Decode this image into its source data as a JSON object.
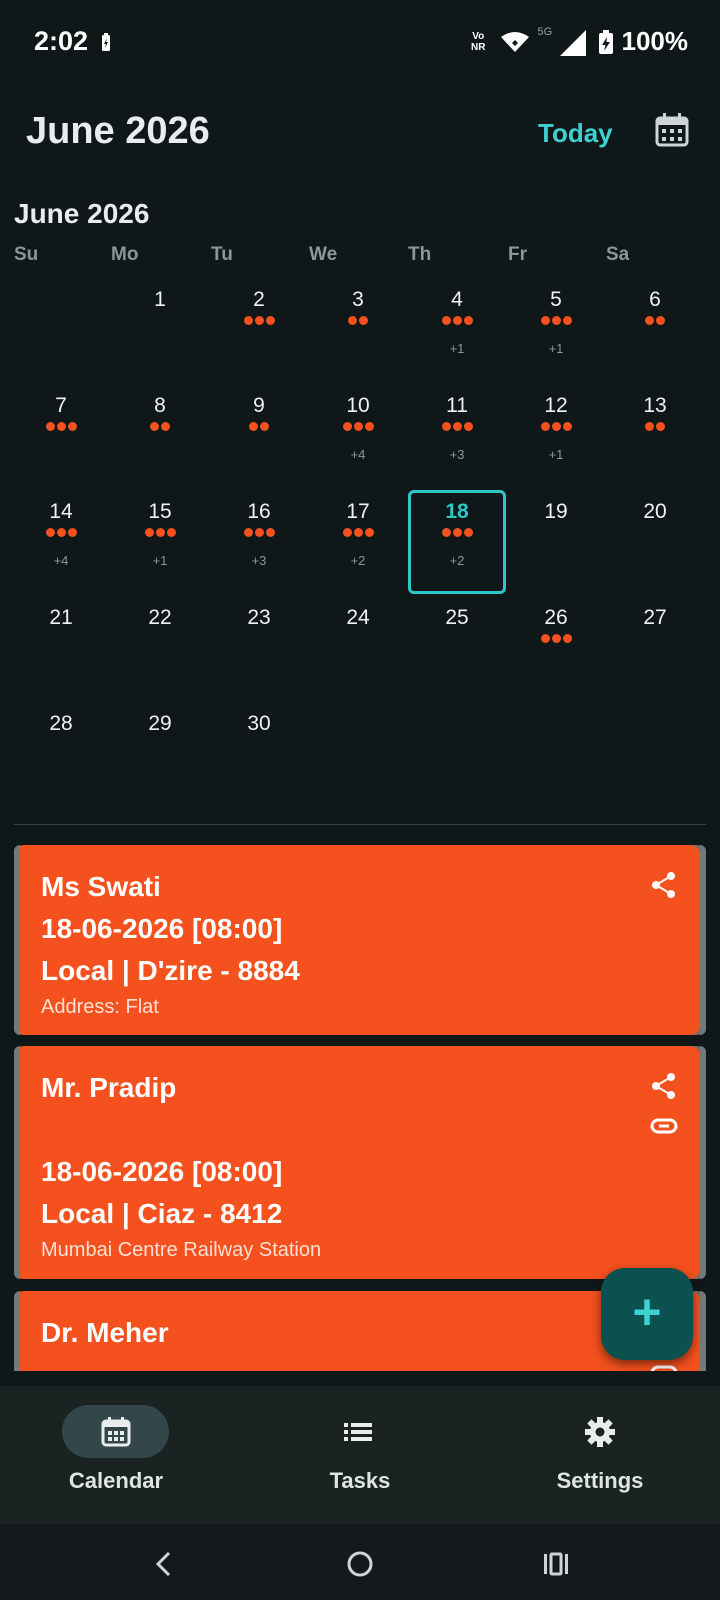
{
  "status_bar": {
    "time": "2:02",
    "volte_top": "Vo",
    "volte_bottom": "NR",
    "network": "5G",
    "battery": "100%"
  },
  "header": {
    "title": "June 2026",
    "today_label": "Today"
  },
  "calendar": {
    "month_label": "June 2026",
    "weekdays": [
      "Su",
      "Mo",
      "Tu",
      "We",
      "Th",
      "Fr",
      "Sa"
    ],
    "selected_day": "18",
    "days": [
      {
        "num": "1",
        "dots": 0,
        "more": ""
      },
      {
        "num": "2",
        "dots": 3,
        "more": ""
      },
      {
        "num": "3",
        "dots": 2,
        "more": ""
      },
      {
        "num": "4",
        "dots": 3,
        "more": "+1"
      },
      {
        "num": "5",
        "dots": 3,
        "more": "+1"
      },
      {
        "num": "6",
        "dots": 2,
        "more": ""
      },
      {
        "num": "7",
        "dots": 3,
        "more": ""
      },
      {
        "num": "8",
        "dots": 2,
        "more": ""
      },
      {
        "num": "9",
        "dots": 2,
        "more": ""
      },
      {
        "num": "10",
        "dots": 3,
        "more": "+4"
      },
      {
        "num": "11",
        "dots": 3,
        "more": "+3"
      },
      {
        "num": "12",
        "dots": 3,
        "more": "+1"
      },
      {
        "num": "13",
        "dots": 2,
        "more": ""
      },
      {
        "num": "14",
        "dots": 3,
        "more": "+4"
      },
      {
        "num": "15",
        "dots": 3,
        "more": "+1"
      },
      {
        "num": "16",
        "dots": 3,
        "more": "+3"
      },
      {
        "num": "17",
        "dots": 3,
        "more": "+2"
      },
      {
        "num": "18",
        "dots": 3,
        "more": "+2"
      },
      {
        "num": "19",
        "dots": 0,
        "more": ""
      },
      {
        "num": "20",
        "dots": 0,
        "more": ""
      },
      {
        "num": "21",
        "dots": 0,
        "more": ""
      },
      {
        "num": "22",
        "dots": 0,
        "more": ""
      },
      {
        "num": "23",
        "dots": 0,
        "more": ""
      },
      {
        "num": "24",
        "dots": 0,
        "more": ""
      },
      {
        "num": "25",
        "dots": 0,
        "more": ""
      },
      {
        "num": "26",
        "dots": 3,
        "more": ""
      },
      {
        "num": "27",
        "dots": 0,
        "more": ""
      },
      {
        "num": "28",
        "dots": 0,
        "more": ""
      },
      {
        "num": "29",
        "dots": 0,
        "more": ""
      },
      {
        "num": "30",
        "dots": 0,
        "more": ""
      }
    ]
  },
  "events": [
    {
      "name": "Ms Swati",
      "datetime": "18-06-2026 [08:00]",
      "vehicle": "Local | D'zire - 8884",
      "address": "Address: Flat",
      "has_link": false
    },
    {
      "name": "Mr. Pradip",
      "datetime": "18-06-2026 [08:00]",
      "vehicle": "Local | Ciaz - 8412",
      "address": "Mumbai Centre Railway Station",
      "has_link": true
    },
    {
      "name": "Dr. Meher",
      "datetime": "",
      "vehicle": "",
      "address": "",
      "has_link": true
    }
  ],
  "fab": {
    "label": "+"
  },
  "bottom_nav": [
    {
      "label": "Calendar",
      "icon": "calendar-icon",
      "active": true
    },
    {
      "label": "Tasks",
      "icon": "list-icon",
      "active": false
    },
    {
      "label": "Settings",
      "icon": "gear-icon",
      "active": false
    }
  ],
  "colors": {
    "background": "#101718",
    "accent": "#3ed1d1",
    "event": "#f4511e",
    "nav": "#1b2222"
  }
}
